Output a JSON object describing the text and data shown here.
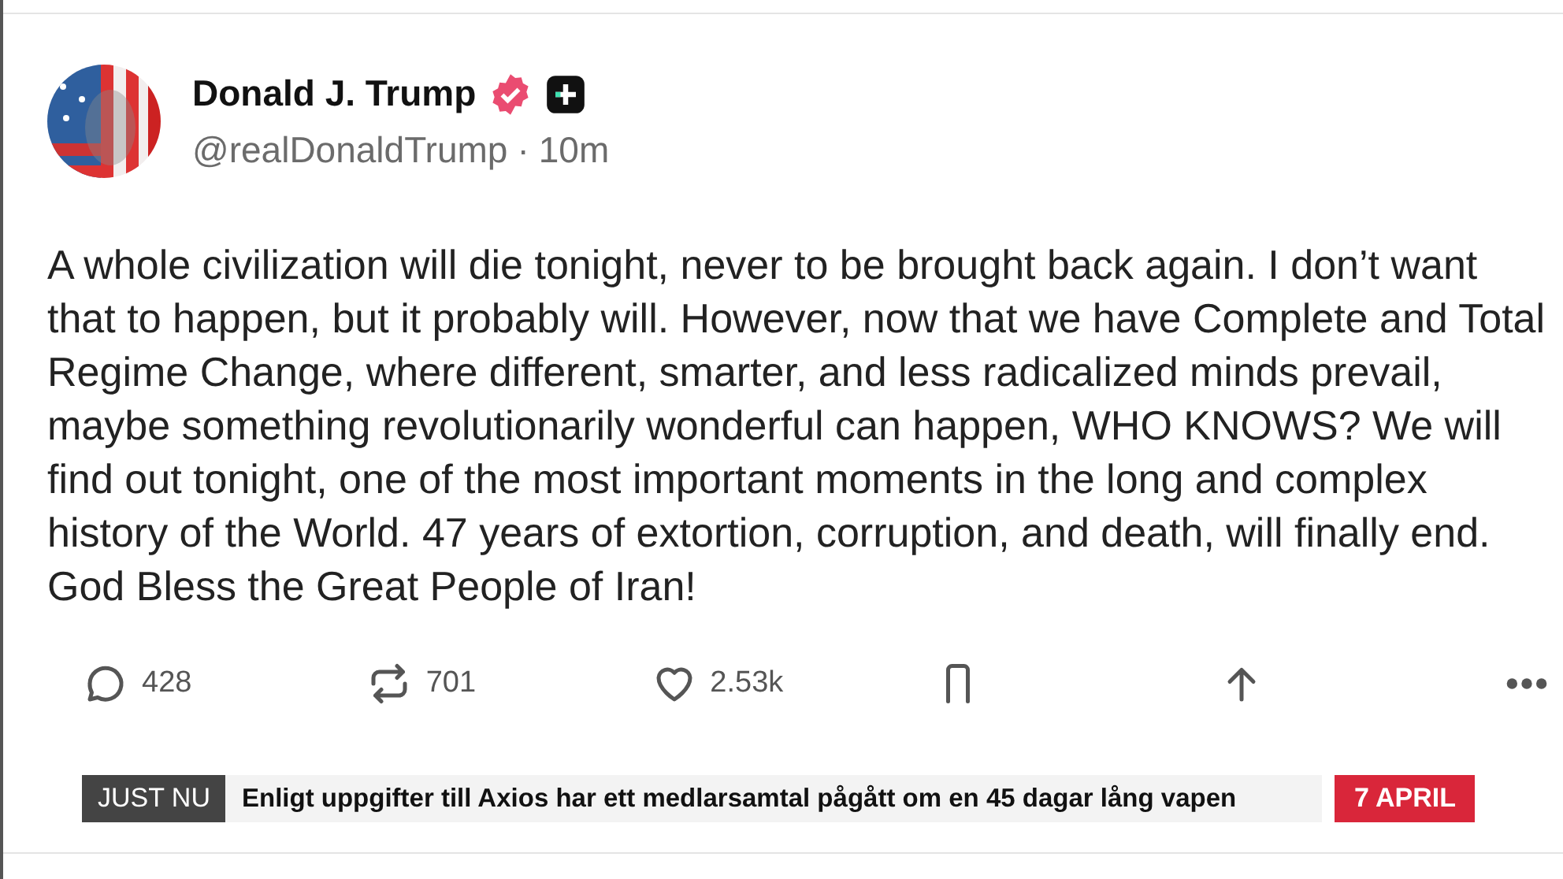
{
  "post": {
    "author": "Donald J. Trump",
    "handle": "@realDonaldTrump",
    "separator": "·",
    "time": "10m",
    "verified": true,
    "body": "A whole civilization will die tonight, never to be brought back again. I don’t want that to happen, but it probably will. However, now that we have Complete and Total Regime Change, where different, smarter, and less radicalized minds prevail, maybe something revolutionarily wonderful can happen, WHO KNOWS? We will find out tonight, one of the most important moments in the long and complex history of the World. 47 years of extortion, corruption, and death, will finally end. God Bless the Great People of Iran!",
    "actions": [
      {
        "kind": "reply",
        "count": "428"
      },
      {
        "kind": "repost",
        "count": "701"
      },
      {
        "kind": "like",
        "count": "2.53k"
      },
      {
        "kind": "bookmark"
      },
      {
        "kind": "share"
      },
      {
        "kind": "more"
      }
    ]
  },
  "ticker": {
    "label": "JUST NU",
    "headline": "Enligt uppgifter till Axios har ett medlarsamtal pågått om en 45 dagar lång vapen",
    "date": "7 APRIL"
  }
}
